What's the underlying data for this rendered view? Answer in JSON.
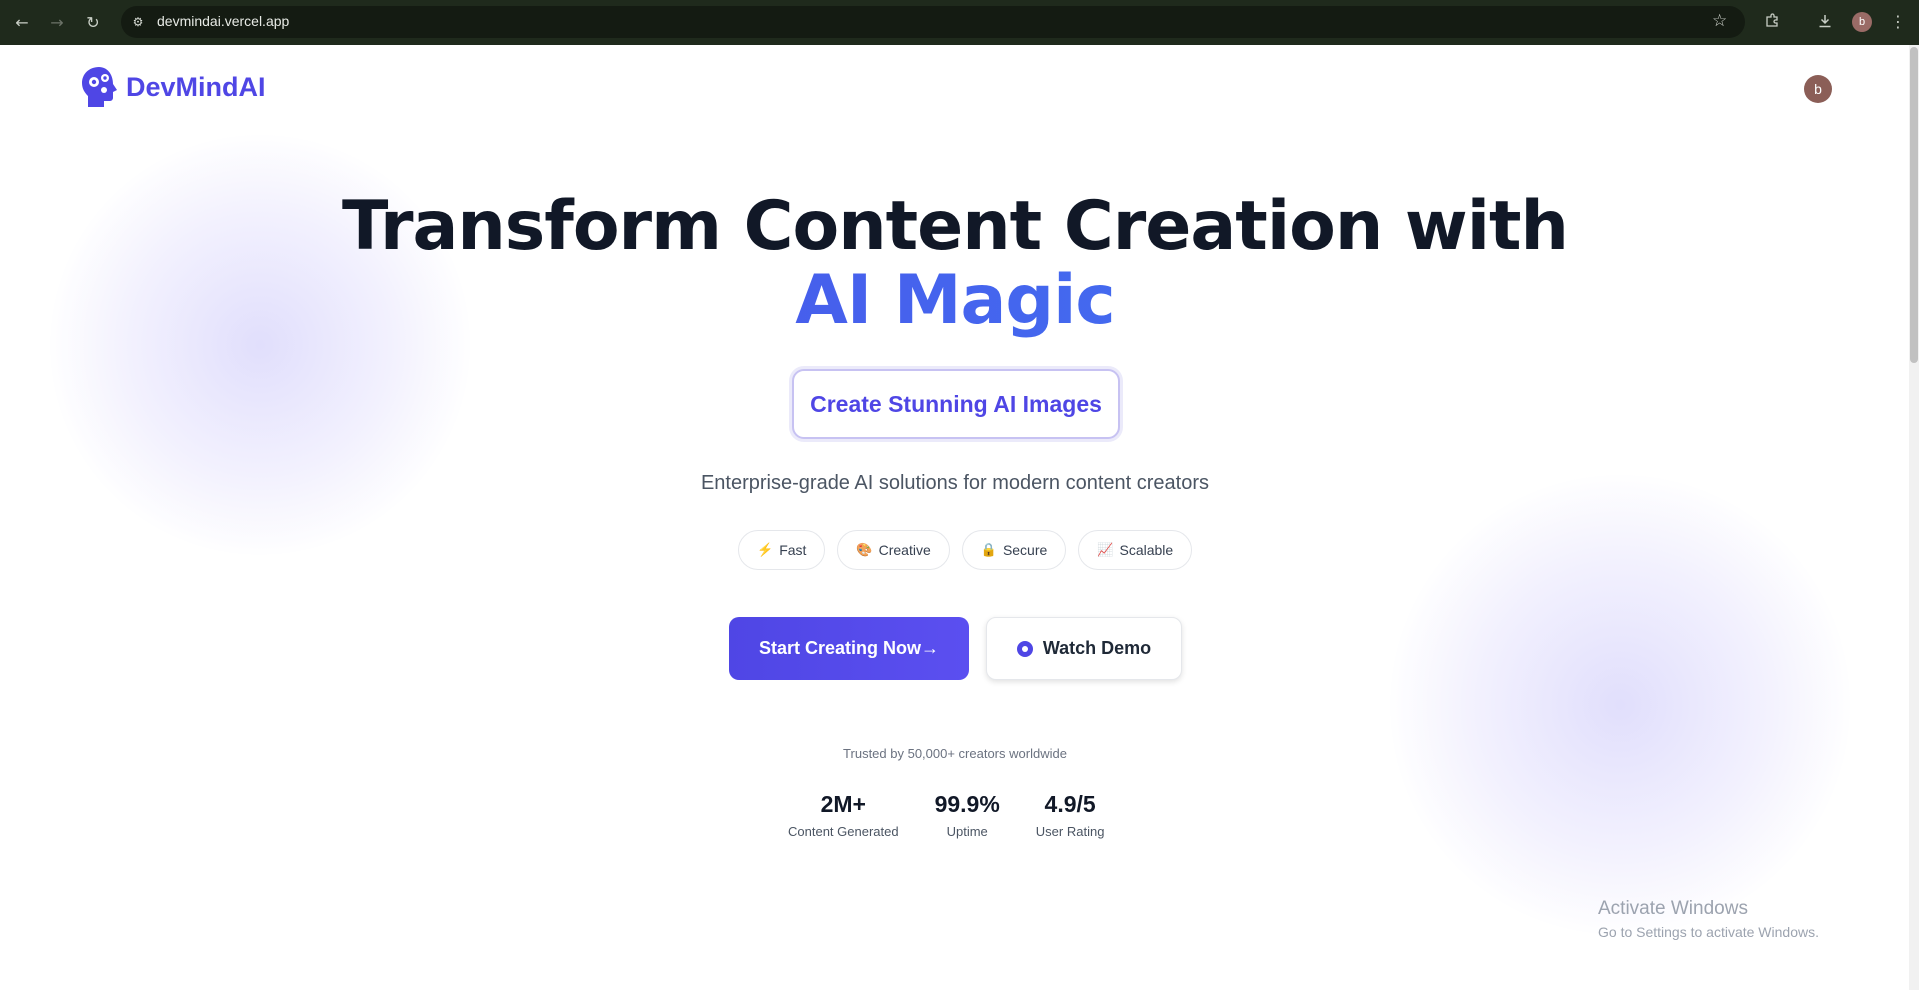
{
  "browser": {
    "url": "devmindai.vercel.app",
    "profile_initial": "b"
  },
  "header": {
    "brand": "DevMindAI",
    "user_initial": "b"
  },
  "hero": {
    "title_line1": "Transform Content Creation with",
    "title_line2": "AI Magic",
    "badge": "Create Stunning AI Images",
    "subtitle": "Enterprise-grade AI solutions for modern content creators"
  },
  "features": [
    {
      "icon": "⚡",
      "label": "Fast"
    },
    {
      "icon": "🎨",
      "label": "Creative"
    },
    {
      "icon": "🔒",
      "label": "Secure"
    },
    {
      "icon": "📈",
      "label": "Scalable"
    }
  ],
  "cta": {
    "primary": "Start Creating Now→",
    "secondary": "Watch Demo"
  },
  "trust": {
    "text": "Trusted by 50,000+ creators worldwide",
    "stats": [
      {
        "value": "2M+",
        "label": "Content Generated"
      },
      {
        "value": "99.9%",
        "label": "Uptime"
      },
      {
        "value": "4.9/5",
        "label": "User Rating"
      }
    ]
  },
  "os_watermark": {
    "title": "Activate Windows",
    "subtitle": "Go to Settings to activate Windows."
  },
  "colors": {
    "accent": "#4f46e5",
    "chrome_bg": "#1f2a1c"
  }
}
